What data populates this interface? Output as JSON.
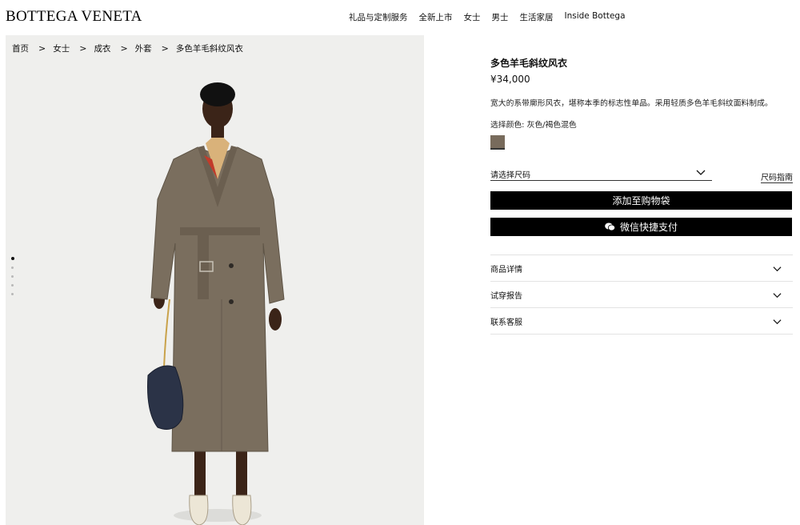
{
  "header": {
    "logo": "BOTTEGA VENETA",
    "nav": [
      "礼品与定制服务",
      "全新上市",
      "女士",
      "男士",
      "生活家居",
      "Inside Bottega"
    ]
  },
  "breadcrumb": [
    "首页",
    "女士",
    "成衣",
    "外套",
    "多色羊毛斜纹风衣"
  ],
  "breadcrumb_sep": ">",
  "gallery": {
    "image_count": 5,
    "active_index": 0
  },
  "product": {
    "title": "多色羊毛斜纹风衣",
    "price": "¥34,000",
    "description": "宽大的系带廓形风衣，堪称本季的标志性单品。采用轻质多色羊毛斜纹面料制成。",
    "color_label": "选择颜色: 灰色/褐色混色",
    "swatch_color": "#786b5c",
    "size_placeholder": "请选择尺码",
    "size_guide": "尺码指南",
    "add_to_bag": "添加至购物袋",
    "wechat_pay": "微信快捷支付",
    "accordion": [
      "商品详情",
      "试穿报告",
      "联系客服"
    ]
  },
  "colors": {
    "coat": "#7a6e5e",
    "bag": "#2b3347",
    "background": "#efefed"
  }
}
